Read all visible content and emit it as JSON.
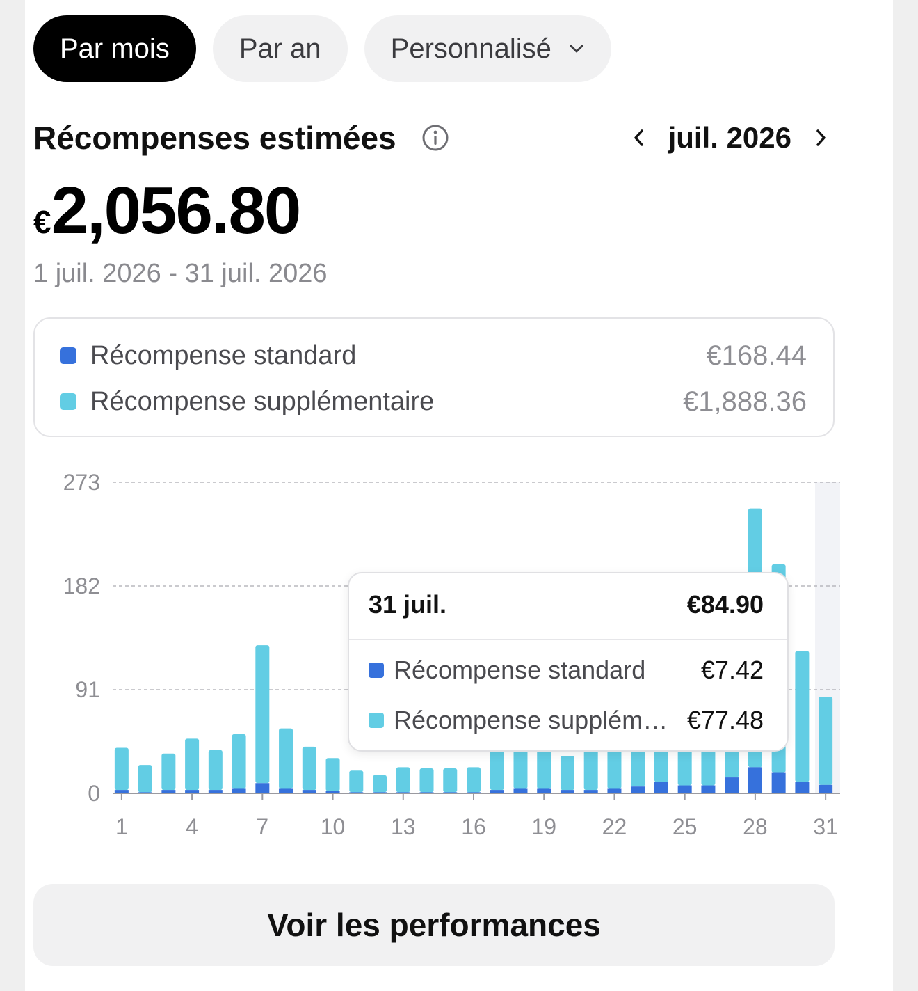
{
  "tabs": [
    {
      "label": "Par mois",
      "active": true
    },
    {
      "label": "Par an",
      "active": false
    },
    {
      "label": "Personnalisé",
      "active": false,
      "icon": "chevron-down-icon"
    }
  ],
  "header": {
    "title": "Récompenses estimées",
    "month": "juil. 2026"
  },
  "summary": {
    "currency": "€",
    "amount": "2,056.80",
    "period": "1 juil. 2026 - 31 juil. 2026"
  },
  "legend": [
    {
      "label": "Récompense standard",
      "value": "€168.44",
      "color": "#3671dc"
    },
    {
      "label": "Récompense supplémentaire",
      "value": "€1,888.36",
      "color": "#62cde4"
    }
  ],
  "tooltip": {
    "date": "31 juil.",
    "total": "€84.90",
    "rows": [
      {
        "label": "Récompense standard",
        "value": "€7.42",
        "color": "#3671dc"
      },
      {
        "label": "Récompense supplémentaire",
        "value": "€77.48",
        "color": "#62cde4"
      }
    ]
  },
  "cta": {
    "label": "Voir les performances"
  },
  "colors": {
    "standard": "#3671dc",
    "extra": "#62cde4",
    "highlight": "#f2f3f7",
    "grid": "#b8b8bd",
    "axis_text": "#8e8e93"
  },
  "chart_data": {
    "type": "bar",
    "stacked": true,
    "ylim": [
      0,
      273
    ],
    "y_ticks": [
      0,
      91,
      182,
      273
    ],
    "x_tick_labels": [
      "1",
      "4",
      "7",
      "10",
      "13",
      "16",
      "19",
      "22",
      "25",
      "28",
      "31"
    ],
    "categories": [
      1,
      2,
      3,
      4,
      5,
      6,
      7,
      8,
      9,
      10,
      11,
      12,
      13,
      14,
      15,
      16,
      17,
      18,
      19,
      20,
      21,
      22,
      23,
      24,
      25,
      26,
      27,
      28,
      29,
      30,
      31
    ],
    "highlighted_category": 31,
    "series": [
      {
        "name": "Récompense standard",
        "values": [
          3,
          1,
          3,
          3,
          3,
          4,
          9,
          4,
          3,
          2,
          1,
          1,
          1,
          1,
          1,
          1,
          3,
          4,
          4,
          3,
          3,
          4,
          6,
          10,
          7,
          7,
          14,
          23,
          18,
          10,
          7.42
        ]
      },
      {
        "name": "Récompense supplémentaire",
        "values": [
          37,
          24,
          32,
          45,
          35,
          48,
          121,
          53,
          38,
          29,
          19,
          15,
          22,
          21,
          21,
          22,
          47,
          47,
          37,
          30,
          46,
          47,
          46,
          46,
          46,
          45,
          60,
          227,
          183,
          115,
          77.48
        ]
      }
    ]
  }
}
